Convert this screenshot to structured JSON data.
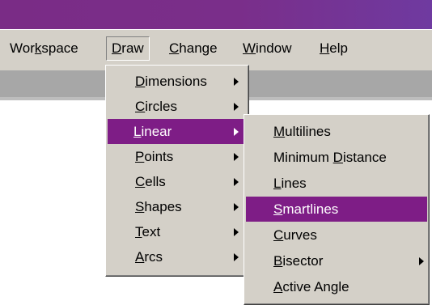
{
  "menubar": {
    "items": [
      {
        "pre": "Wor",
        "key": "k",
        "post": "space"
      },
      {
        "pre": "",
        "key": "D",
        "post": "raw"
      },
      {
        "pre": "",
        "key": "C",
        "post": "hange"
      },
      {
        "pre": "",
        "key": "W",
        "post": "indow"
      },
      {
        "pre": "",
        "key": "H",
        "post": "elp"
      }
    ]
  },
  "draw_menu": {
    "items": [
      {
        "pre": "",
        "key": "D",
        "post": "imensions"
      },
      {
        "pre": "",
        "key": "C",
        "post": "ircles"
      },
      {
        "pre": "",
        "key": "L",
        "post": "inear"
      },
      {
        "pre": "",
        "key": "P",
        "post": "oints"
      },
      {
        "pre": "",
        "key": "C",
        "post": "ells"
      },
      {
        "pre": "",
        "key": "S",
        "post": "hapes"
      },
      {
        "pre": "",
        "key": "T",
        "post": "ext"
      },
      {
        "pre": "",
        "key": "A",
        "post": "rcs"
      }
    ]
  },
  "linear_menu": {
    "items": [
      {
        "pre": "",
        "key": "M",
        "post": "ultilines"
      },
      {
        "pre": "Minimum ",
        "key": "D",
        "post": "istance"
      },
      {
        "pre": "",
        "key": "L",
        "post": "ines"
      },
      {
        "pre": "",
        "key": "S",
        "post": "martlines"
      },
      {
        "pre": "",
        "key": "C",
        "post": "urves"
      },
      {
        "pre": "",
        "key": "B",
        "post": "isector"
      },
      {
        "pre": "",
        "key": "A",
        "post": "ctive Angle"
      }
    ]
  },
  "colors": {
    "titlebar": "#7a2c86",
    "menu_face": "#d4d0c8",
    "highlight": "#7e1d86",
    "toolbar": "#a7a7a7"
  }
}
